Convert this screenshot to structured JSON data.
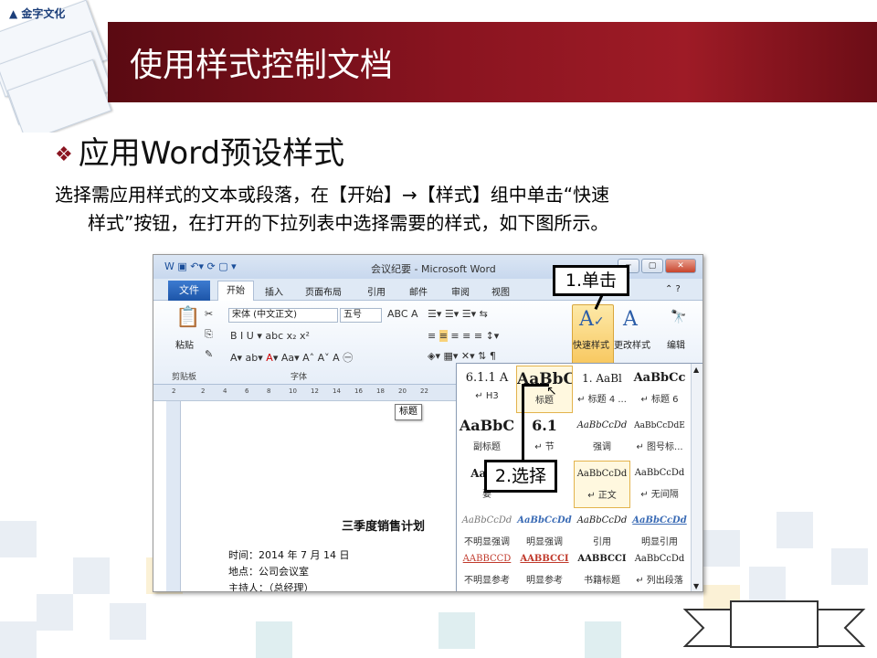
{
  "slide": {
    "title": "使用样式控制文档",
    "logo": "金字文化",
    "heading_word": "应用Word预设样式",
    "para_line1": "选择需应用样式的文本或段落，在【开始】→【样式】组中单击“快速",
    "para_line2": "样式”按钮，在打开的下拉列表中选择需要的样式，如下图所示。",
    "accent": "#8a1420"
  },
  "word": {
    "window_title": "会议纪要 - Microsoft Word",
    "tabs": [
      "文件",
      "开始",
      "插入",
      "页面布局",
      "引用",
      "邮件",
      "审阅",
      "视图"
    ],
    "font_name": "宋体 (中文正文)",
    "font_size": "五号",
    "group_clipboard": "剪贴板",
    "group_font": "字体",
    "paste_label": "粘贴",
    "quick_styles_label": "快速样式",
    "change_styles_label": "更改样式",
    "edit_label": "编辑",
    "ruler_ticks": [
      "2",
      "4",
      "6",
      "8",
      "10",
      "12",
      "14",
      "16",
      "18",
      "20",
      "22"
    ],
    "doc_title": "三季度销售计划",
    "doc_lines": [
      "时间：2014 年 7 月 14 日",
      "地点：公司会议室",
      "主持人：（总经理）"
    ],
    "tooltip": "标题"
  },
  "gallery": {
    "rows": [
      [
        {
          "s": "6.1.1 A",
          "n": "↵ H3"
        },
        {
          "s": "AaBbC",
          "n": "标题"
        },
        {
          "s": "1. AaBl",
          "n": "↵ 标题 4 ..."
        },
        {
          "s": "AaBbCc",
          "n": "↵ 标题 6"
        }
      ],
      [
        {
          "s": "AaBbC",
          "n": "副标题"
        },
        {
          "s": "6.1",
          "n": "↵ 节"
        },
        {
          "s": "AaBbCcDd",
          "n": "强调"
        },
        {
          "s": "AaBbCcDdE",
          "n": "↵ 图号标..."
        }
      ],
      [
        {
          "s": "AaBb",
          "n": "要"
        },
        {
          "s": "",
          "n": ""
        },
        {
          "s": "AaBbCcDd",
          "n": "↵ 正文"
        },
        {
          "s": "AaBbCcDd",
          "n": "↵ 无间隔"
        }
      ],
      [
        {
          "s": "AaBbCcDd",
          "n": "不明显强调"
        },
        {
          "s": "AaBbCcDd",
          "n": "明显强调"
        },
        {
          "s": "AaBbCcDd",
          "n": "引用"
        },
        {
          "s": "AaBbCcDd",
          "n": "明显引用"
        }
      ],
      [
        {
          "s": "AABBCCD",
          "n": "不明显参考"
        },
        {
          "s": "AABBCCI",
          "n": "明显参考"
        },
        {
          "s": "AABBCCI",
          "n": "书籍标题"
        },
        {
          "s": "AaBbCcDd",
          "n": "↵ 列出段落"
        }
      ]
    ]
  },
  "callouts": {
    "step1": "1.单击",
    "step2": "2.选择"
  }
}
